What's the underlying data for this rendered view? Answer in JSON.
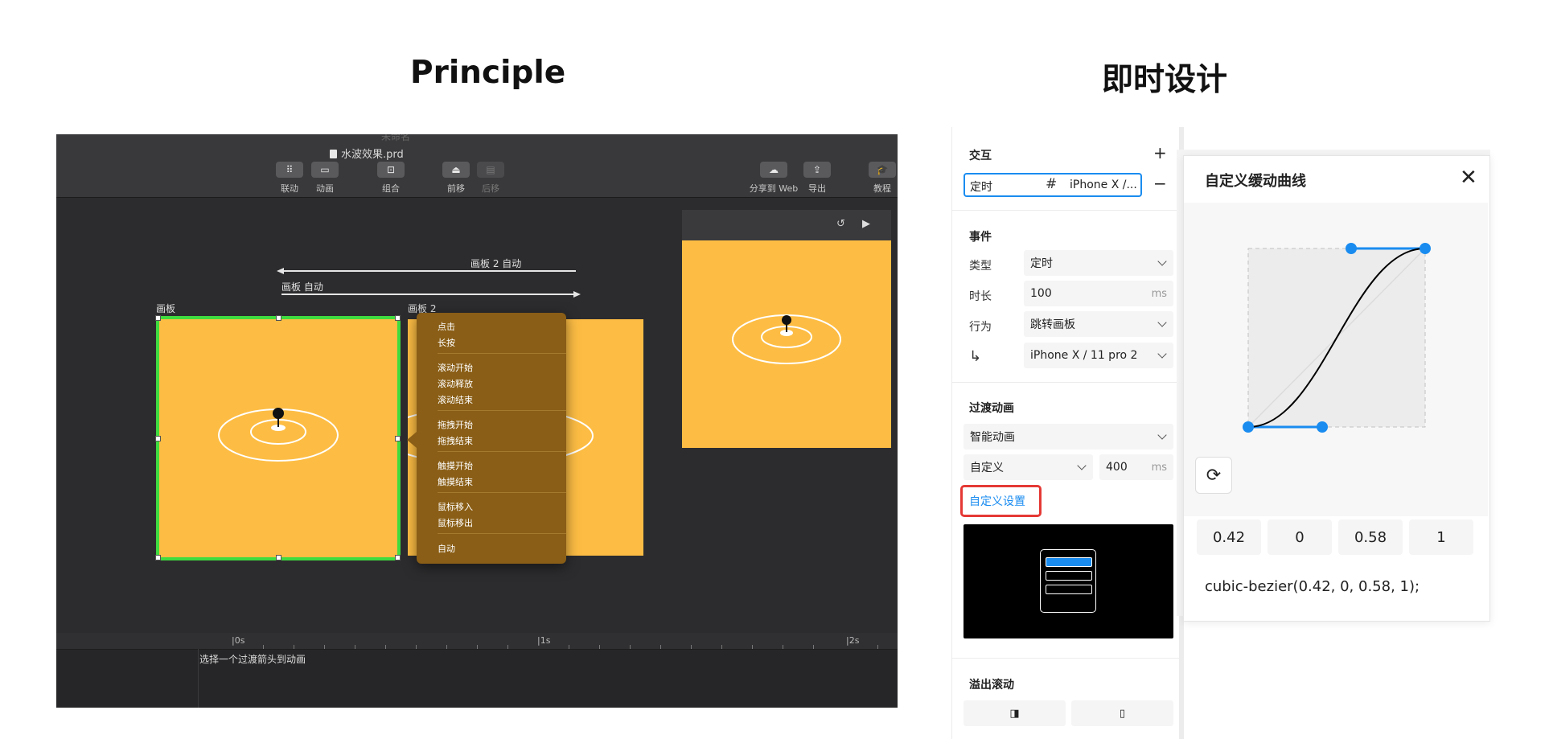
{
  "headings": {
    "left": "Principle",
    "right": "即时设计"
  },
  "principle": {
    "window_title_faded": "未命名",
    "file_name": "水波效果.prd",
    "toolbar": [
      {
        "label": "联动",
        "icon": "link-dots-icon",
        "enabled": true
      },
      {
        "label": "动画",
        "icon": "animate-icon",
        "enabled": true
      },
      {
        "label": "组合",
        "icon": "group-icon",
        "enabled": true
      },
      {
        "label": "前移",
        "icon": "bring-forward-icon",
        "enabled": true
      },
      {
        "label": "后移",
        "icon": "send-backward-icon",
        "enabled": false
      },
      {
        "label": "分享到 Web",
        "icon": "cloud-upload-icon",
        "enabled": true
      },
      {
        "label": "导出",
        "icon": "export-icon",
        "enabled": true
      },
      {
        "label": "教程",
        "icon": "graduation-cap-icon",
        "enabled": true
      }
    ],
    "canvas": {
      "arrow1_label": "画板 2 自动",
      "arrow2_label": "画板 自动",
      "artboard1_label": "画板",
      "artboard2_label": "画板 2"
    },
    "context_menu": {
      "groups": [
        [
          "点击",
          "长按"
        ],
        [
          "滚动开始",
          "滚动释放",
          "滚动结束"
        ],
        [
          "拖拽开始",
          "拖拽结束"
        ],
        [
          "触摸开始",
          "触摸结束"
        ],
        [
          "鼠标移入",
          "鼠标移出"
        ],
        [
          "自动"
        ]
      ]
    },
    "timeline": {
      "ticks": [
        "0s",
        "1s",
        "2s"
      ],
      "hint": "选择一个过渡箭头到动画"
    },
    "colors": {
      "artboard": "#fdbd44",
      "selection": "#3fdb3f",
      "menu": "#8a5e16"
    }
  },
  "jsd": {
    "interaction": {
      "title": "交互",
      "add": "+",
      "remove": "−",
      "trigger_label": "定时",
      "trigger_target": "iPhone X /..."
    },
    "event": {
      "title": "事件",
      "type_label": "类型",
      "type_value": "定时",
      "duration_label": "时长",
      "duration_value": "100",
      "duration_unit": "ms",
      "action_label": "行为",
      "action_value": "跳转画板",
      "target_value": "iPhone X / 11 pro 2"
    },
    "transition": {
      "title": "过渡动画",
      "animation_value": "智能动画",
      "easing_value": "自定义",
      "duration_value": "400",
      "duration_unit": "ms",
      "custom_link": "自定义设置"
    },
    "overflow": {
      "title": "溢出滚动"
    },
    "accent": "#1a8cf0",
    "highlight": "#e53935"
  },
  "curve": {
    "title": "自定义缓动曲线",
    "values": [
      "0.42",
      "0",
      "0.58",
      "1"
    ],
    "css": "cubic-bezier(0.42, 0, 0.58, 1);"
  }
}
